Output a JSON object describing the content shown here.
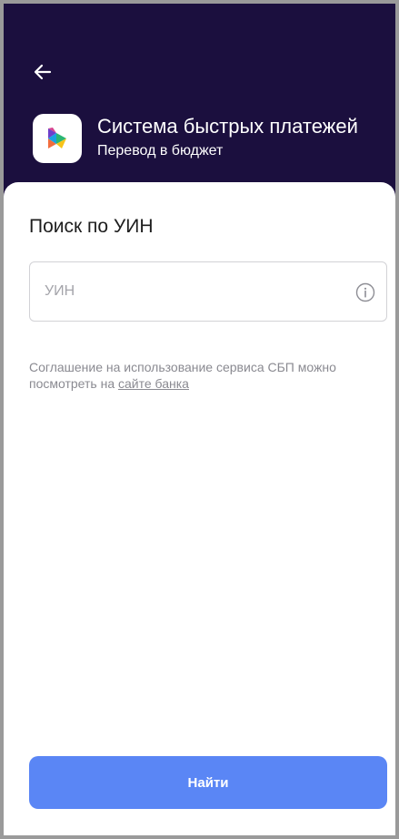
{
  "header": {
    "title": "Система быстрых платежей",
    "subtitle": "Перевод в бюджет"
  },
  "icons": {
    "back": "arrow-left-icon",
    "logo": "sbp-logo-icon",
    "info": "info-circle-icon"
  },
  "search": {
    "title": "Поиск по УИН",
    "placeholder": "УИН",
    "value": ""
  },
  "agreement": {
    "text": "Соглашение на использование сервиса СБП можно посмотреть на ",
    "link_text": "сайте банка"
  },
  "actions": {
    "find_label": "Найти"
  },
  "colors": {
    "header_bg": "#1b0f3e",
    "primary_button": "#5a86f5",
    "muted_text": "#8a8a91"
  }
}
